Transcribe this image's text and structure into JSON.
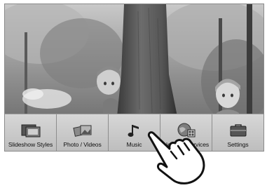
{
  "menu": {
    "items": [
      {
        "label": "Slideshow Styles",
        "icon": "slideshow-styles-icon"
      },
      {
        "label": "Photo / Videos",
        "icon": "photo-videos-icon"
      },
      {
        "label": "Music",
        "icon": "music-note-icon"
      },
      {
        "label": "Network Services",
        "icon": "globe-network-icon"
      },
      {
        "label": "Settings",
        "icon": "toolbox-settings-icon"
      }
    ]
  },
  "pointer": {
    "icon": "tap-hand-icon"
  },
  "colors": {
    "menu_bar": "#c9c9c9",
    "frame_border": "#8a8a8a"
  }
}
